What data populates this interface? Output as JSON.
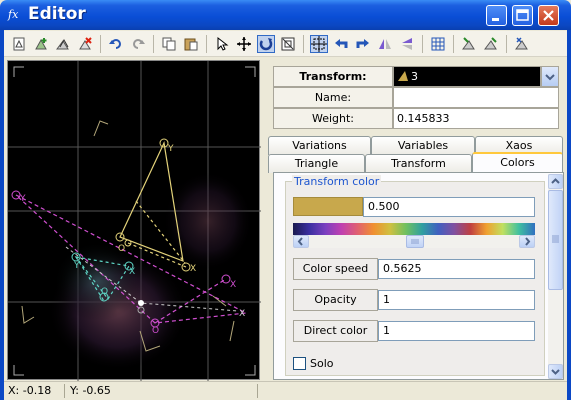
{
  "window": {
    "title": "Editor",
    "title_icon": "fx-icon"
  },
  "toolbar": {
    "icons": [
      "new-triangle-icon",
      "add-transform-icon",
      "duplicate-icon",
      "delete-icon",
      "undo-icon",
      "redo-icon",
      "copy-icon",
      "paste-icon",
      "select-pointer-icon",
      "move-icon",
      "rotate-icon",
      "scale-icon",
      "pivot-icon",
      "rotate-left-icon",
      "rotate-right-icon",
      "flip-horizontal-icon",
      "flip-vertical-icon",
      "grid-icon",
      "reset-icon",
      "reset-all-icon",
      "options-icon"
    ]
  },
  "canvas": {
    "triangle_labels": [
      "Y",
      "X",
      "O",
      "Y",
      "X",
      "O",
      "Y",
      "X",
      "O",
      "X"
    ]
  },
  "status": {
    "x_label": "X: -0.18",
    "y_label": "Y: -0.65"
  },
  "props": {
    "transform_label": "Transform:",
    "transform_value": "3",
    "name_label": "Name:",
    "name_value": "",
    "weight_label": "Weight:",
    "weight_value": "0.145833"
  },
  "tabs": {
    "row1": [
      "Variations",
      "Variables",
      "Xaos"
    ],
    "row2": [
      "Triangle",
      "Transform",
      "Colors"
    ],
    "active": "Colors"
  },
  "colors_tab": {
    "group_title": "Transform color",
    "color_value": "0.500",
    "color_speed_label": "Color speed",
    "color_speed_value": "0.5625",
    "opacity_label": "Opacity",
    "opacity_value": "1",
    "direct_color_label": "Direct color",
    "direct_color_value": "1",
    "solo_label": "Solo",
    "swatch_color": "#c8a84c"
  },
  "colors": {
    "title_bar": "#0a4ed6",
    "accent_tab": "#ffc83c",
    "triangle_yellow": "#e3d27a",
    "triangle_magenta": "#d04fd0",
    "triangle_cyan": "#5fd6c6",
    "close_button": "#c4391b"
  }
}
